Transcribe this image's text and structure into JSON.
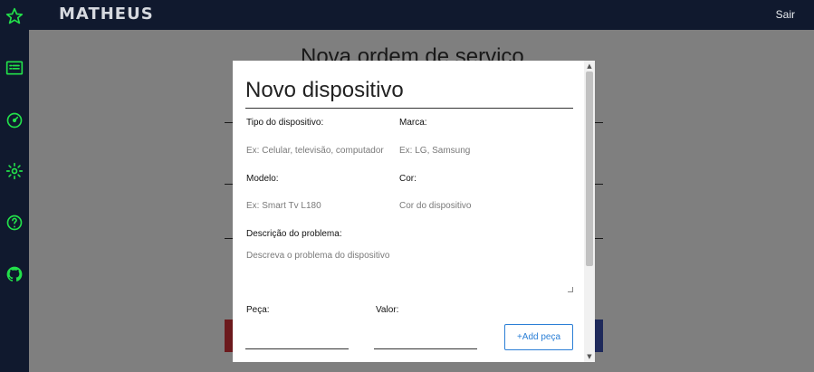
{
  "header": {
    "brand": "MATHEUS",
    "logout_label": "Sair"
  },
  "sidebar": {
    "items": [
      {
        "icon": "star-icon"
      },
      {
        "icon": "list-card-icon"
      },
      {
        "icon": "dashboard-gauge-icon"
      },
      {
        "icon": "gear-icon"
      },
      {
        "icon": "help-circle-icon"
      },
      {
        "icon": "github-icon"
      }
    ],
    "accent": "#22e04a"
  },
  "page": {
    "title": "Nova ordem de serviço"
  },
  "modal": {
    "title": "Novo dispositivo",
    "fields": {
      "tipo": {
        "label": "Tipo do dispositivo:",
        "placeholder": "Ex: Celular, televisão, computador"
      },
      "marca": {
        "label": "Marca:",
        "placeholder": "Ex: LG, Samsung"
      },
      "modelo": {
        "label": "Modelo:",
        "placeholder": "Ex: Smart Tv L180"
      },
      "cor": {
        "label": "Cor:",
        "placeholder": "Cor do dispositivo"
      },
      "descricao": {
        "label": "Descrição do problema:",
        "placeholder": "Descreva o problema do dispositivo"
      },
      "peca": {
        "label": "Peça:",
        "placeholder": ""
      },
      "valor": {
        "label": "Valor:",
        "placeholder": ""
      }
    },
    "add_part_label": "+Add peça"
  },
  "colors": {
    "navbar": "#10192e",
    "accent": "#22e04a",
    "button_blue": "#2b7fd6"
  }
}
